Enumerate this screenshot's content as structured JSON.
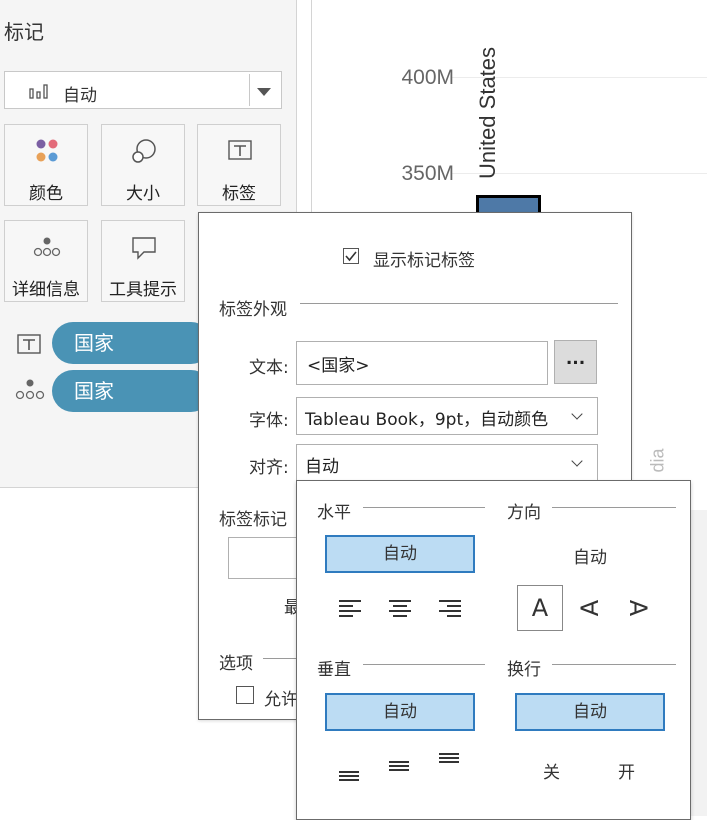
{
  "marks": {
    "title": "标记",
    "mark_type": "自动",
    "cards": [
      {
        "label": "颜色",
        "icon": "color-dots-icon"
      },
      {
        "label": "大小",
        "icon": "size-circles-icon"
      },
      {
        "label": "标签",
        "icon": "label-text-icon"
      },
      {
        "label": "详细信息",
        "icon": "detail-dots-icon"
      },
      {
        "label": "工具提示",
        "icon": "tooltip-bubble-icon"
      }
    ],
    "fields": [
      {
        "icon": "label-text-icon",
        "name": "国家"
      },
      {
        "icon": "detail-dots-icon",
        "name": "国家"
      }
    ],
    "color_dots": [
      "#7b5fa3",
      "#e36b7a",
      "#e8a158",
      "#5b9bd5"
    ]
  },
  "chart": {
    "ticks": [
      "400M",
      "350M"
    ],
    "bar_label": "United States",
    "partial_label": "dia",
    "bar_color": "#4e79a7"
  },
  "label_dialog": {
    "show_labels": "显示标记标签",
    "show_labels_checked": true,
    "appearance_title": "标签外观",
    "text_label": "文本:",
    "text_value": "<国家>",
    "more_button": "...",
    "font_label": "字体:",
    "font_value": "Tableau Book，9pt，自动颜色",
    "align_label": "对齐:",
    "align_value": "自动",
    "marks_to_label": "标签标记",
    "partial_most": "最",
    "options_title": "选项",
    "allow_partial": "允许"
  },
  "align_popover": {
    "horizontal_title": "水平",
    "horizontal_selected": "自动",
    "direction_title": "方向",
    "direction_value": "自动",
    "direction_glyph": "A",
    "vertical_title": "垂直",
    "vertical_selected": "自动",
    "wrap_title": "换行",
    "wrap_selected": "自动",
    "wrap_off": "关",
    "wrap_on": "开"
  }
}
